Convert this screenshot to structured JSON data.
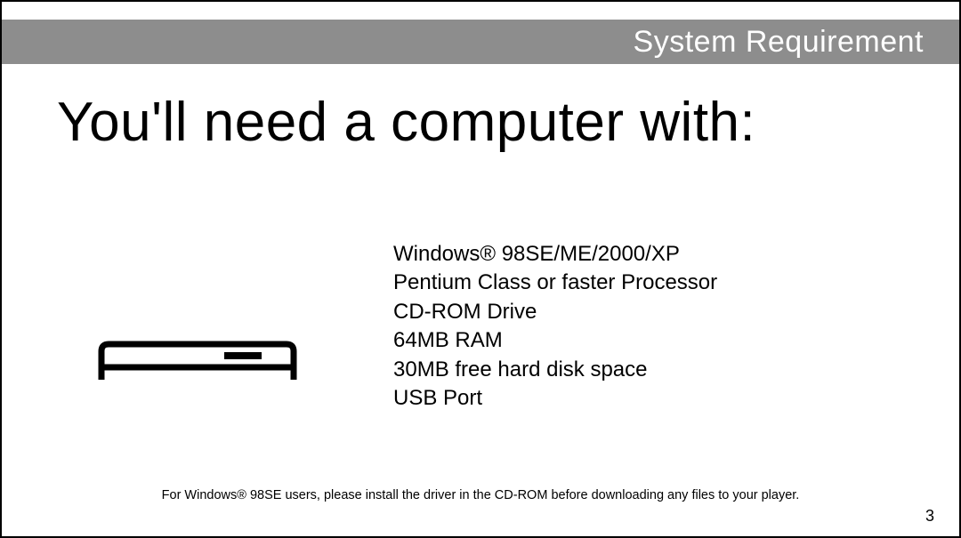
{
  "header": {
    "section_title": "System Requirement"
  },
  "body": {
    "heading": "You'll need a computer with:",
    "requirements": [
      "Windows® 98SE/ME/2000/XP",
      "Pentium Class or faster Processor",
      "CD-ROM Drive",
      "64MB RAM",
      "30MB free hard disk space",
      "USB Port"
    ]
  },
  "footer": {
    "note": "For Windows® 98SE users, please install the driver in the CD-ROM before downloading any files to your player.",
    "page_number": "3"
  }
}
